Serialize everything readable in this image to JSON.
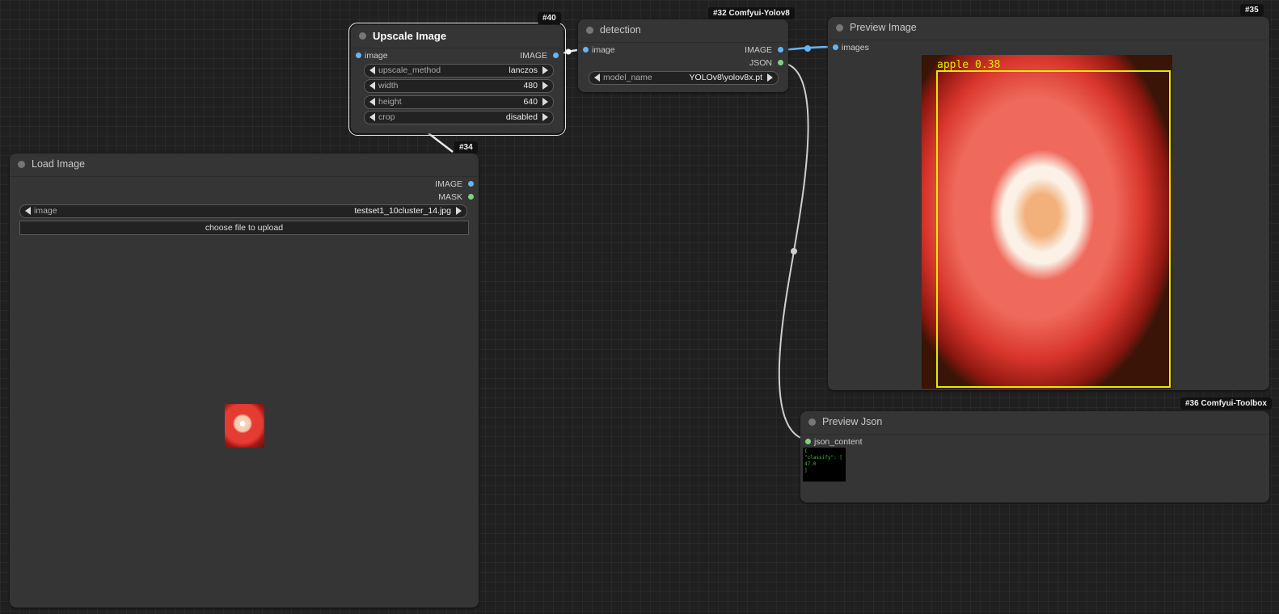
{
  "nodes": {
    "upscale": {
      "badge": "#40",
      "title": "Upscale Image",
      "input_image": "image",
      "output_image": "IMAGE",
      "widgets": [
        {
          "name": "upscale_method",
          "value": "lanczos"
        },
        {
          "name": "width",
          "value": "480"
        },
        {
          "name": "height",
          "value": "640"
        },
        {
          "name": "crop",
          "value": "disabled"
        }
      ]
    },
    "detection": {
      "badge": "#32 Comfyui-Yolov8",
      "title": "detection",
      "input_image": "image",
      "output_image": "IMAGE",
      "output_json": "JSON",
      "widget": {
        "name": "model_name",
        "value": "YOLOv8\\yolov8x.pt"
      }
    },
    "preview_image": {
      "badge": "#35",
      "title": "Preview Image",
      "input_images": "images",
      "bbox_label": "apple  0.38"
    },
    "load_image": {
      "badge": "#34",
      "title": "Load Image",
      "output_image": "IMAGE",
      "output_mask": "MASK",
      "widget": {
        "name": "image",
        "value": "testset1_10cluster_14.jpg"
      },
      "upload_button": "choose file to upload"
    },
    "preview_json": {
      "badge": "#36 Comfyui-Toolbox",
      "title": "Preview Json",
      "input_json": "json_content",
      "json_text": "{\n\"classify\": [\n47.0\n]"
    }
  },
  "colors": {
    "canvas": "#202020",
    "node_bg": "#353535",
    "image_slot": "#64b5f6",
    "mask_slot": "#7bd67b",
    "link_image": "#64b5f6",
    "link_json": "#cfcfcf",
    "bbox": "#d8f000"
  }
}
